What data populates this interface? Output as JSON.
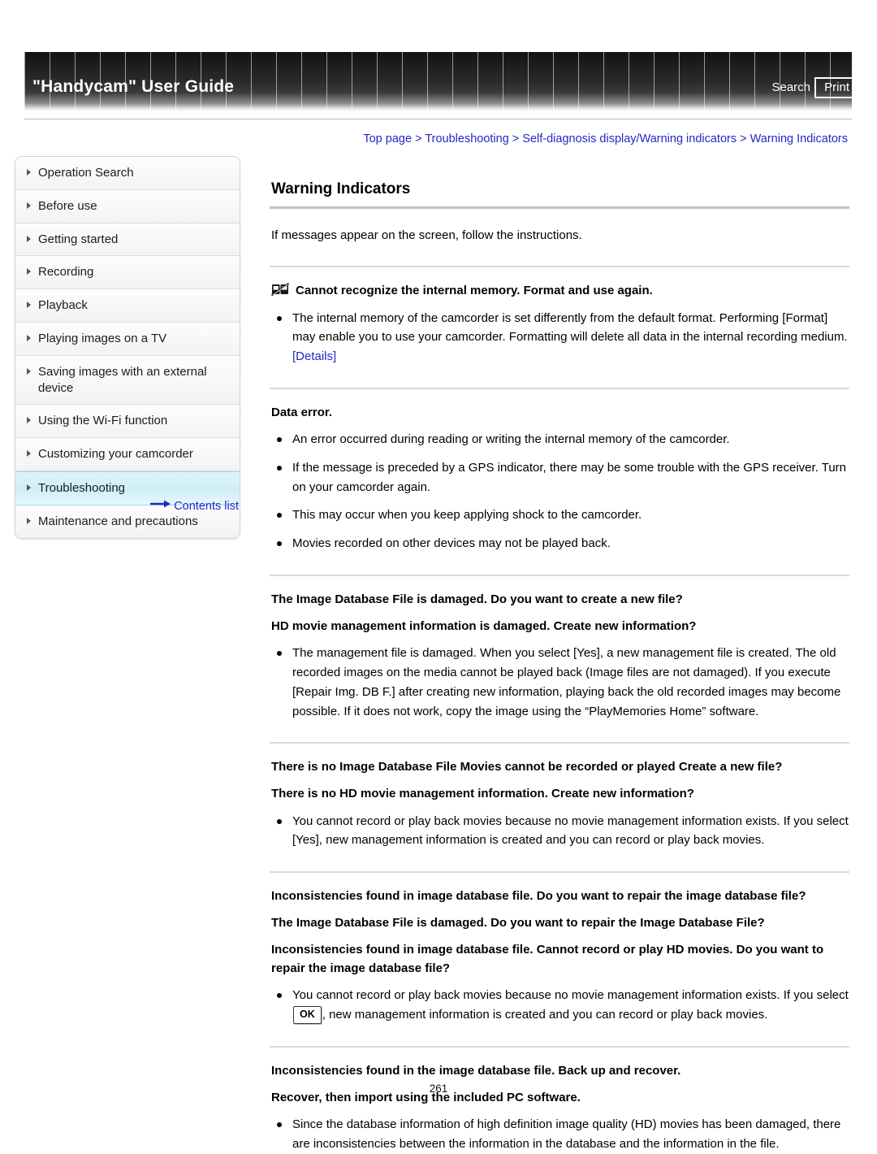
{
  "header": {
    "title": "\"Handycam\" User Guide",
    "search_label": "Search",
    "print_label": "Print"
  },
  "breadcrumb": {
    "items": [
      "Top page",
      "Troubleshooting",
      "Self-diagnosis display/Warning indicators",
      "Warning Indicators"
    ],
    "separator": ">",
    "link_color": "#2626c8"
  },
  "sidebar": {
    "items": [
      {
        "label": "Operation Search",
        "selected": false
      },
      {
        "label": "Before use",
        "selected": false
      },
      {
        "label": "Getting started",
        "selected": false
      },
      {
        "label": "Recording",
        "selected": false
      },
      {
        "label": "Playback",
        "selected": false
      },
      {
        "label": "Playing images on a TV",
        "selected": false
      },
      {
        "label": "Saving images with an external device",
        "selected": false
      },
      {
        "label": "Using the Wi-Fi function",
        "selected": false
      },
      {
        "label": "Customizing your camcorder",
        "selected": false
      },
      {
        "label": "Troubleshooting",
        "selected": true
      },
      {
        "label": "Maintenance and precautions",
        "selected": false
      }
    ],
    "contents_link": "Contents list",
    "selected_bg": "#cfeef8"
  },
  "main": {
    "page_title": "Warning Indicators",
    "intro": "If messages appear on the screen, follow the instructions.",
    "sections": [
      {
        "icon": "memory-card-error-icon",
        "titles": [
          "Cannot recognize the internal memory. Format and use again."
        ],
        "bullets": [
          {
            "pre": "The internal memory of the camcorder is set differently from the default format. Performing [Format] may enable you to use your camcorder. Formatting will delete all data in the internal recording medium. ",
            "link": "[Details]",
            "post": ""
          }
        ]
      },
      {
        "icon": null,
        "titles": [
          "Data error."
        ],
        "bullets": [
          {
            "pre": "An error occurred during reading or writing the internal memory of the camcorder.",
            "link": null,
            "post": ""
          },
          {
            "pre": "If the message is preceded by a GPS indicator, there may be some trouble with the GPS receiver. Turn on your camcorder again.",
            "link": null,
            "post": ""
          },
          {
            "pre": "This may occur when you keep applying shock to the camcorder.",
            "link": null,
            "post": ""
          },
          {
            "pre": "Movies recorded on other devices may not be played back.",
            "link": null,
            "post": ""
          }
        ]
      },
      {
        "icon": null,
        "titles": [
          "The Image Database File is damaged. Do you want to create a new file?",
          "HD movie management information is damaged. Create new information?"
        ],
        "bullets": [
          {
            "pre": "The management file is damaged. When you select [Yes], a new management file is created. The old recorded images on the media cannot be played back (Image files are not damaged). If you execute [Repair Img. DB F.] after creating new information, playing back the old recorded images may become possible. If it does not work, copy the image using the “PlayMemories Home” software.",
            "link": null,
            "post": ""
          }
        ]
      },
      {
        "icon": null,
        "titles": [
          "There is no Image Database File Movies cannot be recorded or played Create a new file?",
          "There is no HD movie management information. Create new information?"
        ],
        "bullets": [
          {
            "pre": "You cannot record or play back movies because no movie management information exists. If you select [Yes], new management information is created and you can record or play back movies.",
            "link": null,
            "post": ""
          }
        ]
      },
      {
        "icon": null,
        "titles": [
          "Inconsistencies found in image database file. Do you want to repair the image database file?",
          "The Image Database File is damaged. Do you want to repair the Image Database File?",
          "Inconsistencies found in image database file. Cannot record or play HD movies. Do you want to repair the image database file?"
        ],
        "bullets": [
          {
            "pre": "You cannot record or play back movies because no movie management information exists. If you select ",
            "key": "OK",
            "post": ", new management information is created and you can record or play back movies."
          }
        ]
      },
      {
        "icon": null,
        "titles": [
          "Inconsistencies found in the image database file. Back up and recover.",
          "Recover, then import using the included PC software."
        ],
        "bullets": [
          {
            "pre": "Since the database information of high definition image quality (HD) movies has been damaged, there are inconsistencies between the information in the database and the information in the file.",
            "link": null,
            "post": ""
          }
        ]
      }
    ]
  },
  "footer": {
    "page_number": "261"
  }
}
